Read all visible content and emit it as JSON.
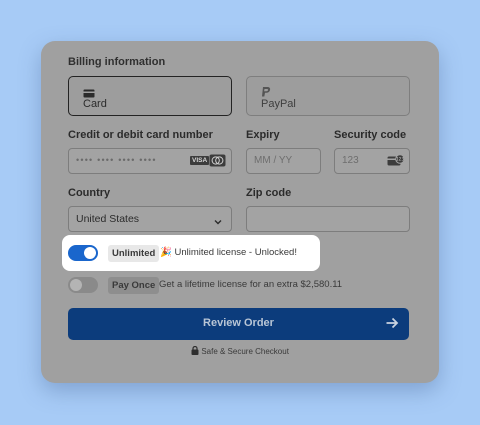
{
  "billing": {
    "title": "Billing information",
    "methods": [
      {
        "label": "Card",
        "icon": "credit-card-icon",
        "selected": true
      },
      {
        "label": "PayPal",
        "icon": "paypal-icon",
        "selected": false
      }
    ]
  },
  "fields": {
    "card_number": {
      "label": "Credit or debit card number",
      "placeholder": "•••• •••• •••• ••••"
    },
    "expiry": {
      "label": "Expiry",
      "placeholder": "MM / YY"
    },
    "security": {
      "label": "Security code",
      "placeholder": "123"
    },
    "country": {
      "label": "Country",
      "value": "United States"
    },
    "zip": {
      "label": "Zip code",
      "value": ""
    }
  },
  "card_brands": [
    "VISA"
  ],
  "options": {
    "unlimited": {
      "badge": "Unlimited",
      "text": "🎉 Unlimited license - Unlocked!",
      "enabled": true
    },
    "pay_once": {
      "badge": "Pay Once",
      "text": "Get a lifetime license for an extra $2,580.11",
      "enabled": false
    }
  },
  "actions": {
    "review_label": "Review Order"
  },
  "footer": {
    "secure_text": "Safe & Secure Checkout"
  },
  "colors": {
    "background": "#a7cbf6",
    "primary": "#0c3c7c",
    "toggle_on": "#1a66cc",
    "highlight": "#ffffff"
  }
}
